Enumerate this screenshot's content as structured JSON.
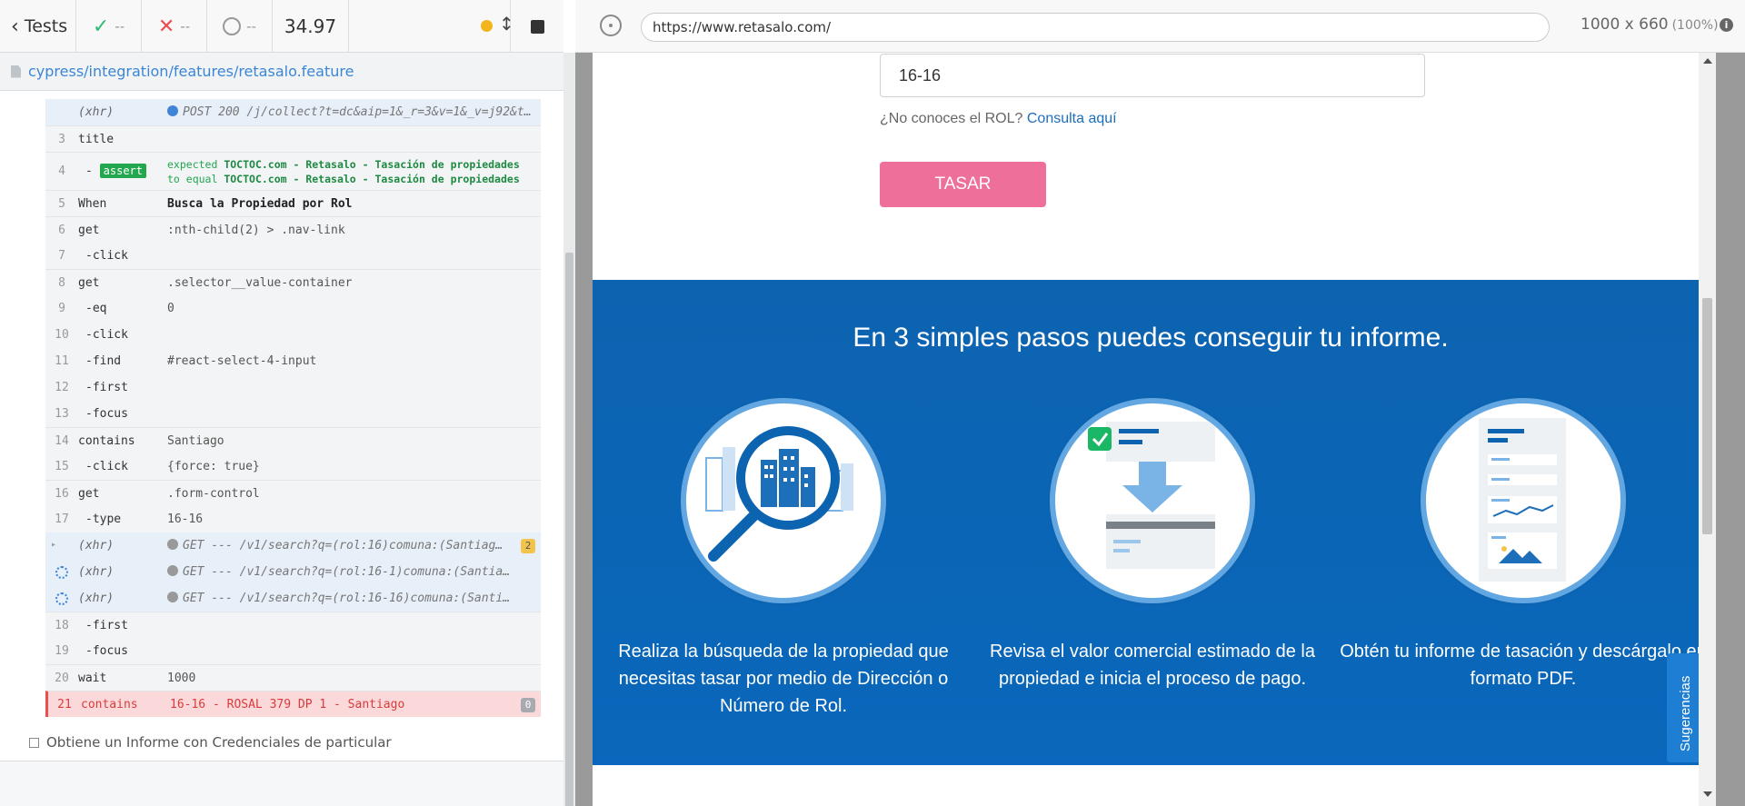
{
  "reporter": {
    "back_label": "Tests",
    "stats": {
      "passed": "--",
      "failed": "--",
      "pending": "--"
    },
    "duration": "34.97",
    "spec_path": "cypress/integration/features/retasalo.feature",
    "next_test_label": "Obtiene un Informe con Credenciales de particular"
  },
  "commands": [
    {
      "num": "",
      "name": "(xhr)",
      "msg": "POST 200 /j/collect?t=dc&aip=1&_r=3&v=1&_v=j92&tid=UA…",
      "type": "xhr-top"
    },
    {
      "num": "3",
      "name": "title",
      "msg": "",
      "type": "parent"
    },
    {
      "num": "4",
      "name": "assert",
      "msg_line1_prefix": "expected",
      "msg_line1_value": "TOCTOC.com - Retasalo - Tasación de propiedades",
      "msg_line2_prefix": "to equal",
      "msg_line2_value": "TOCTOC.com - Retasalo - Tasación de propiedades",
      "type": "assert"
    },
    {
      "num": "5",
      "name": "When",
      "msg": "Busca la Propiedad por Rol",
      "type": "step"
    },
    {
      "num": "6",
      "name": "get",
      "msg": ":nth-child(2) > .nav-link",
      "type": "parent"
    },
    {
      "num": "7",
      "name": "-click",
      "msg": "",
      "type": "child"
    },
    {
      "num": "8",
      "name": "get",
      "msg": ".selector__value-container",
      "type": "parent"
    },
    {
      "num": "9",
      "name": "-eq",
      "msg": "0",
      "type": "child"
    },
    {
      "num": "10",
      "name": "-click",
      "msg": "",
      "type": "child"
    },
    {
      "num": "11",
      "name": "-find",
      "msg": "#react-select-4-input",
      "type": "child"
    },
    {
      "num": "12",
      "name": "-first",
      "msg": "",
      "type": "child"
    },
    {
      "num": "13",
      "name": "-focus",
      "msg": "",
      "type": "child"
    },
    {
      "num": "14",
      "name": "contains",
      "msg": "Santiago",
      "type": "parent"
    },
    {
      "num": "15",
      "name": "-click",
      "msg": "{force: true}",
      "type": "child"
    },
    {
      "num": "16",
      "name": "get",
      "msg": ".form-control",
      "type": "parent"
    },
    {
      "num": "17",
      "name": "-type",
      "msg": "16-16",
      "type": "child"
    },
    {
      "num": "",
      "name": "(xhr)",
      "msg": "GET --- /v1/search?q=(rol:16)comuna:(Santiag…",
      "type": "xhr-group",
      "badge": "2"
    },
    {
      "num": "",
      "name": "(xhr)",
      "msg": "GET --- /v1/search?q=(rol:16-1)comuna:(Santia…",
      "type": "xhr-pending"
    },
    {
      "num": "",
      "name": "(xhr)",
      "msg": "GET --- /v1/search?q=(rol:16-16)comuna:(Santi…",
      "type": "xhr-pending"
    },
    {
      "num": "18",
      "name": "-first",
      "msg": "",
      "type": "child"
    },
    {
      "num": "19",
      "name": "-focus",
      "msg": "",
      "type": "child"
    },
    {
      "num": "20",
      "name": "wait",
      "msg": "1000",
      "type": "parent"
    },
    {
      "num": "21",
      "name": "contains",
      "msg": "16-16 - ROSAL 379 DP 1 - Santiago",
      "type": "failed",
      "badge": "0"
    }
  ],
  "aut": {
    "url": "https://www.retasalo.com/",
    "viewport": "1000 x 660",
    "zoom": "(100%)"
  },
  "site": {
    "rol_value": "16-16",
    "rol_help_text": "¿No conoces el ROL?",
    "rol_help_link": "Consulta aquí",
    "tasar_label": "TASAR",
    "steps_title": "En 3 simples pasos puedes conseguir tu informe.",
    "steps": [
      {
        "caption": "Realiza la búsqueda de la propiedad que necesitas tasar por medio de Dirección o Número de Rol."
      },
      {
        "caption": "Revisa el valor comercial estimado de la propiedad e inicia el proceso de pago."
      },
      {
        "caption": "Obtén tu informe de tasación y descárgalo en formato PDF."
      }
    ],
    "sugerencias_label": "Sugerencias"
  },
  "colors": {
    "primary_blue": "#0c63b0",
    "tasar_pink": "#ee6f9a",
    "pass_green": "#2ebc75",
    "fail_red": "#e94f4f"
  }
}
